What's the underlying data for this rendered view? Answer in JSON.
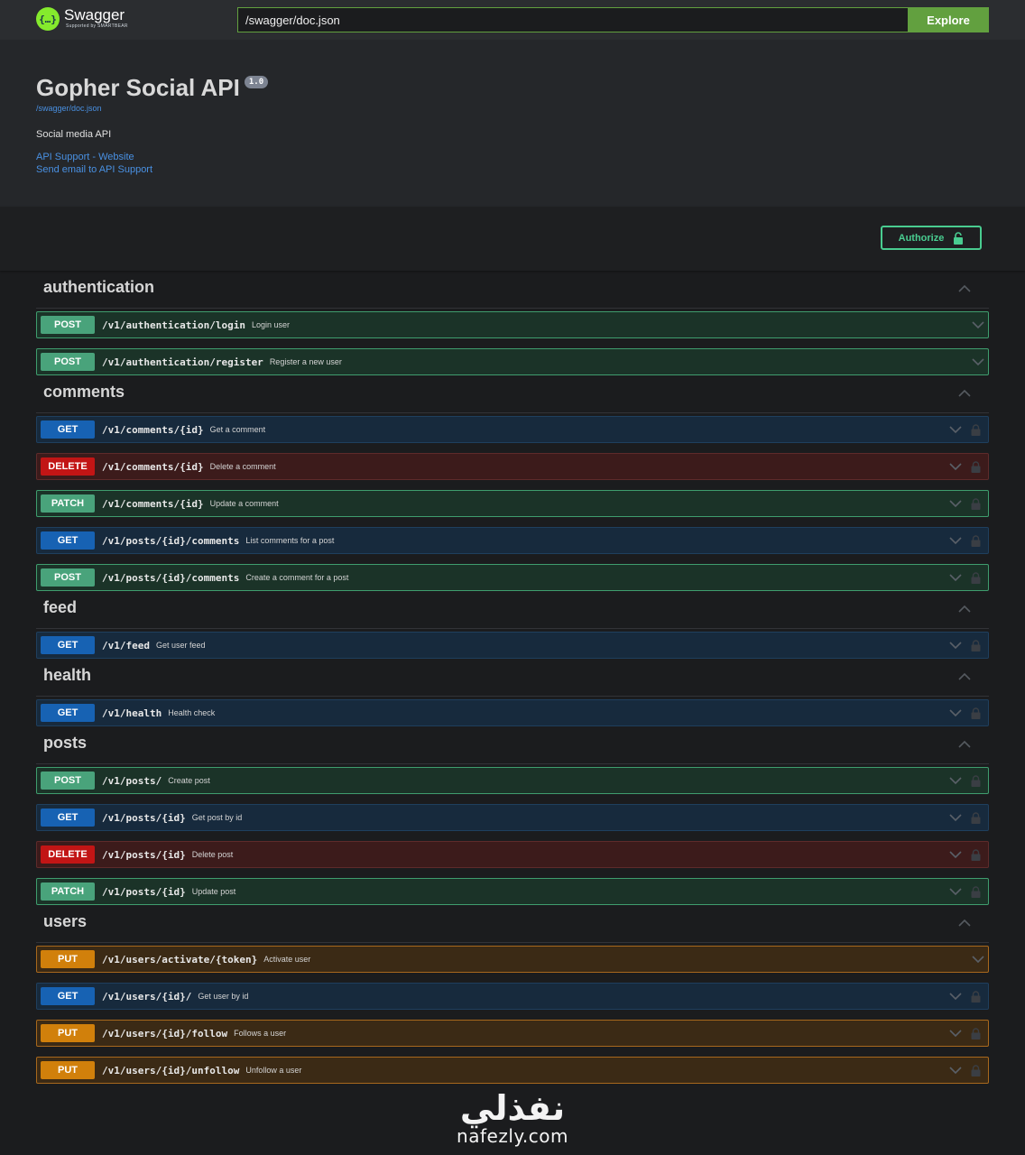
{
  "topbar": {
    "logo_name": "Swagger",
    "logo_sub": "Supported by SMARTBEAR",
    "url_value": "/swagger/doc.json",
    "explore_label": "Explore"
  },
  "info": {
    "title": "Gopher Social API",
    "version": "1.0",
    "doc_link": "/swagger/doc.json",
    "description": "Social media API",
    "contact_website": "API Support - Website",
    "contact_email": "Send email to API Support"
  },
  "scheme": {
    "authorize_label": "Authorize"
  },
  "tags": [
    {
      "name": "authentication",
      "operations": [
        {
          "method": "POST",
          "path": "/v1/authentication/login",
          "summary": "Login user",
          "locked": false
        },
        {
          "method": "POST",
          "path": "/v1/authentication/register",
          "summary": "Register a new user",
          "locked": false
        }
      ]
    },
    {
      "name": "comments",
      "operations": [
        {
          "method": "GET",
          "path": "/v1/comments/{id}",
          "summary": "Get a comment",
          "locked": true
        },
        {
          "method": "DELETE",
          "path": "/v1/comments/{id}",
          "summary": "Delete a comment",
          "locked": true
        },
        {
          "method": "PATCH",
          "path": "/v1/comments/{id}",
          "summary": "Update a comment",
          "locked": true
        },
        {
          "method": "GET",
          "path": "/v1/posts/{id}/comments",
          "summary": "List comments for a post",
          "locked": true
        },
        {
          "method": "POST",
          "path": "/v1/posts/{id}/comments",
          "summary": "Create a comment for a post",
          "locked": true
        }
      ]
    },
    {
      "name": "feed",
      "operations": [
        {
          "method": "GET",
          "path": "/v1/feed",
          "summary": "Get user feed",
          "locked": true
        }
      ]
    },
    {
      "name": "health",
      "operations": [
        {
          "method": "GET",
          "path": "/v1/health",
          "summary": "Health check",
          "locked": true
        }
      ]
    },
    {
      "name": "posts",
      "operations": [
        {
          "method": "POST",
          "path": "/v1/posts/",
          "summary": "Create post",
          "locked": true
        },
        {
          "method": "GET",
          "path": "/v1/posts/{id}",
          "summary": "Get post by id",
          "locked": true
        },
        {
          "method": "DELETE",
          "path": "/v1/posts/{id}",
          "summary": "Delete post",
          "locked": true
        },
        {
          "method": "PATCH",
          "path": "/v1/posts/{id}",
          "summary": "Update post",
          "locked": true
        }
      ]
    },
    {
      "name": "users",
      "operations": [
        {
          "method": "PUT",
          "path": "/v1/users/activate/{token}",
          "summary": "Activate user",
          "locked": false
        },
        {
          "method": "GET",
          "path": "/v1/users/{id}/",
          "summary": "Get user by id",
          "locked": true
        },
        {
          "method": "PUT",
          "path": "/v1/users/{id}/follow",
          "summary": "Follows a user",
          "locked": true
        },
        {
          "method": "PUT",
          "path": "/v1/users/{id}/unfollow",
          "summary": "Unfollow a user",
          "locked": true
        }
      ]
    }
  ],
  "watermark": {
    "arabic": "نفذلي",
    "latin": "nafezly.com"
  },
  "colors": {
    "post": "#49a37b",
    "get": "#1762b3",
    "delete": "#c21515",
    "patch": "#49a37b",
    "put": "#d1800b",
    "accent": "#62a03f",
    "authorize": "#49cc90"
  }
}
